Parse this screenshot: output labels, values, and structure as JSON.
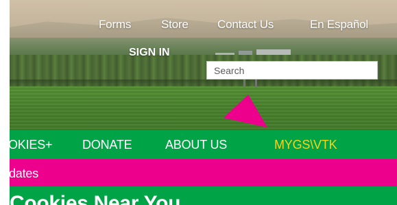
{
  "utility_nav": {
    "forms": "Forms",
    "store": "Store",
    "contact_us": "Contact Us",
    "espanol": "En Español"
  },
  "sign_in": "SIGN IN",
  "search": {
    "placeholder": "Search",
    "value": ""
  },
  "main_nav": {
    "items": [
      {
        "label": "OKIES+"
      },
      {
        "label": "DONATE"
      },
      {
        "label": "ABOUT US"
      },
      {
        "label": "MYGS\\VTK"
      }
    ]
  },
  "updates_bar": {
    "text": "dates"
  },
  "heading": {
    "text": "Cookies Near You"
  },
  "colors": {
    "green": "#00a346",
    "pink": "#ec008c",
    "highlight": "#f2d61c",
    "white": "#ffffff"
  }
}
